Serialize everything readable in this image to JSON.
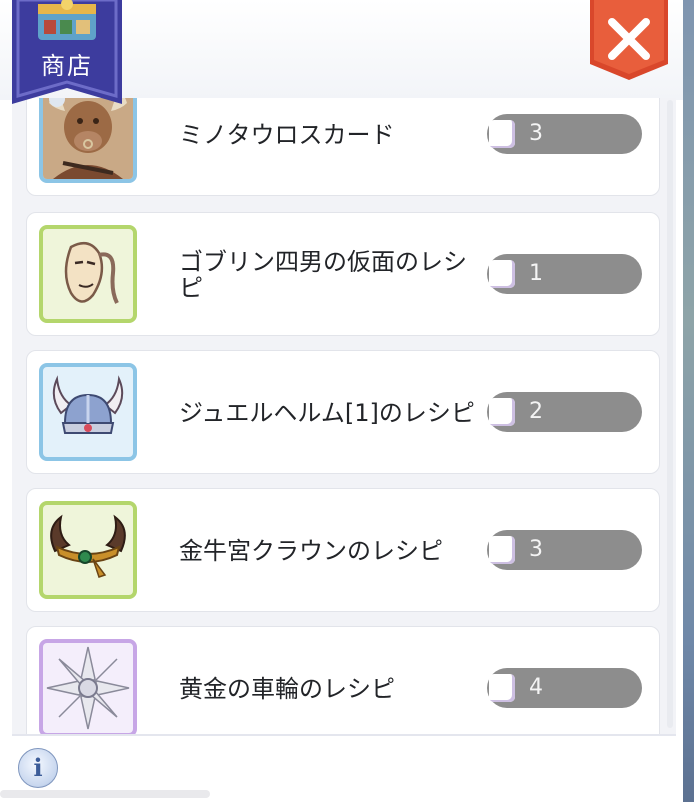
{
  "header": {
    "shop_label": "商店"
  },
  "items": [
    {
      "name": "ミノタウロスカード",
      "quantity": "3",
      "icon": "minotaur-card-icon"
    },
    {
      "name": "ゴブリン四男の仮面のレシピ",
      "quantity": "1",
      "icon": "mask-icon"
    },
    {
      "name": "ジュエルヘルム[1]のレシピ",
      "quantity": "2",
      "icon": "horned-helm-icon"
    },
    {
      "name": "金牛宮クラウンのレシピ",
      "quantity": "3",
      "icon": "horn-crown-icon"
    },
    {
      "name": "黄金の車輪のレシピ",
      "quantity": "4",
      "icon": "golden-wheel-icon"
    }
  ],
  "footer": {
    "info_symbol": "i"
  },
  "colors": {
    "close_red": "#d9472b",
    "banner_purple": "#3d3c9e",
    "pill_gray": "#8d8d8d"
  }
}
